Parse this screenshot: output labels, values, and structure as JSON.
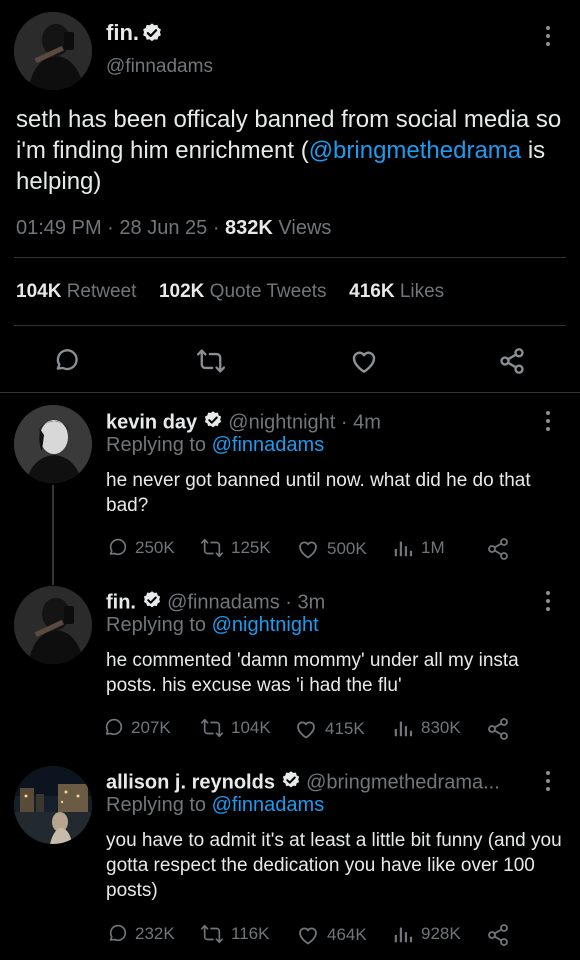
{
  "main_tweet": {
    "display_name": "fin.",
    "handle": "@finnadams",
    "text_before": "seth has been officaly banned from social media so i'm finding him enrichment (",
    "mention": "@bringmethedrama",
    "text_after": " is helping)",
    "time": "01:49 PM",
    "date": "28 Jun 25",
    "views_count": "832K",
    "views_label": "Views",
    "retweets_count": "104K",
    "retweets_label": "Retweet",
    "quotes_count": "102K",
    "quotes_label": "Quote Tweets",
    "likes_count": "416K",
    "likes_label": "Likes"
  },
  "replies": [
    {
      "display_name": "kevin day",
      "handle": "@nightnight",
      "time": "4m",
      "replying_label": "Replying to",
      "replying_to": "@finnadams",
      "text": "he never got banned until now. what did he do that bad?",
      "replies": "250K",
      "retweets": "125K",
      "likes": "500K",
      "views": "1M"
    },
    {
      "display_name": "fin.",
      "handle": "@finnadams",
      "time": "3m",
      "replying_label": "Replying to",
      "replying_to": "@nightnight",
      "text": "he commented 'damn mommy' under all my insta posts. his excuse was 'i had the flu'",
      "replies": "207K",
      "retweets": "104K",
      "likes": "415K",
      "views": "830K"
    },
    {
      "display_name": "allison j. reynolds",
      "handle": "@bringmethedrama...",
      "time": "",
      "replying_label": "Replying to",
      "replying_to": "@finnadams",
      "text": "you have to admit it's at least a little bit funny (and you gotta respect the dedication you have like over 100 posts)",
      "replies": "232K",
      "retweets": "116K",
      "likes": "464K",
      "views": "928K"
    }
  ],
  "colors": {
    "background": "#000000",
    "text": "#e7e9ea",
    "muted": "#71767b",
    "accent": "#1d9bf0",
    "divider": "#2f3336"
  },
  "icons": [
    "more-icon",
    "reply-icon",
    "retweet-icon",
    "like-icon",
    "share-icon",
    "views-icon",
    "verified-icon"
  ]
}
